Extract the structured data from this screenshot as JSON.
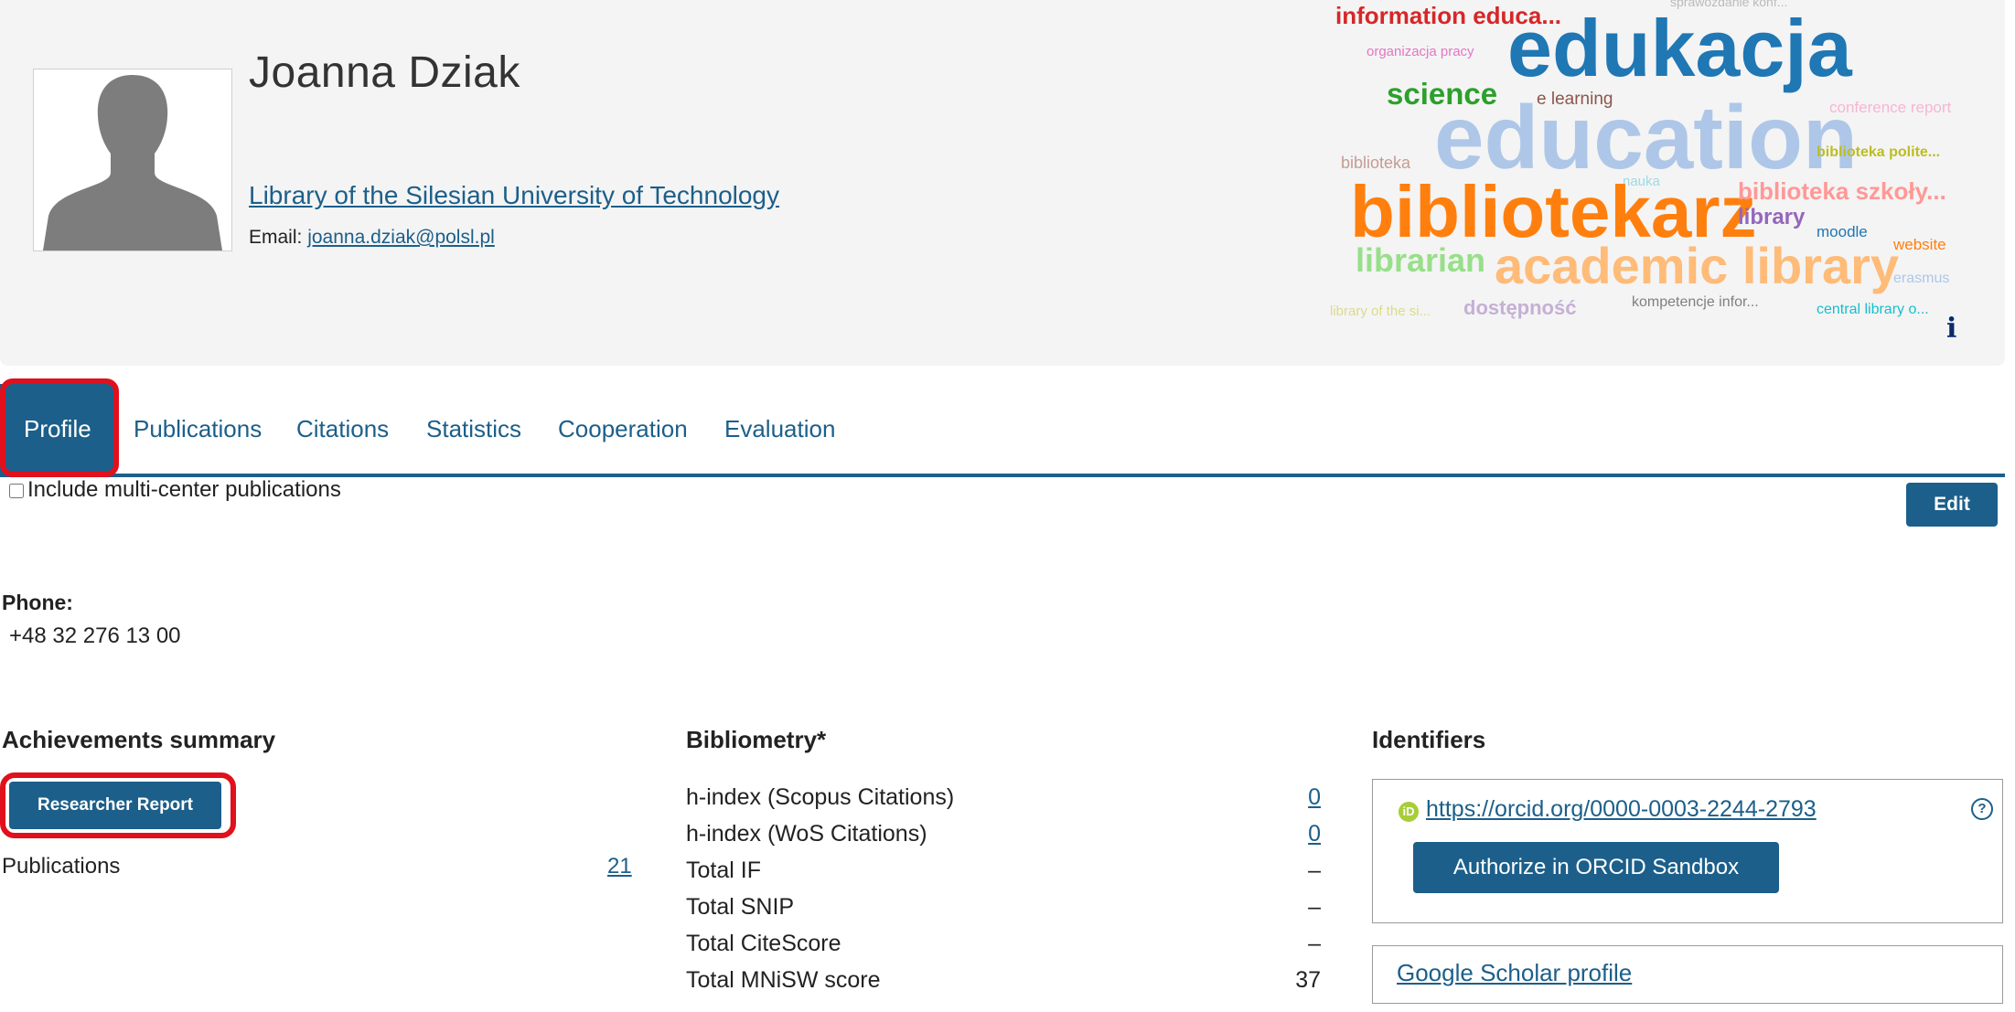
{
  "profile": {
    "name": "Joanna Dziak",
    "affiliation": "Library of the Silesian University of Technology",
    "email_label": "Email:",
    "email": "joanna.dziak@polsl.pl"
  },
  "word_cloud": [
    {
      "text": "sprawozdanie konf...",
      "color": "#bbbbbb"
    },
    {
      "text": "information educa...",
      "color": "#d62728"
    },
    {
      "text": "edukacja",
      "color": "#1f77b4"
    },
    {
      "text": "organizacja pracy",
      "color": "#e377c2"
    },
    {
      "text": "science",
      "color": "#2ca02c"
    },
    {
      "text": "e learning",
      "color": "#8c564b"
    },
    {
      "text": "conference report",
      "color": "#f7b6d2"
    },
    {
      "text": "education",
      "color": "#aec7e8"
    },
    {
      "text": "biblioteka",
      "color": "#c49c94"
    },
    {
      "text": "nauka",
      "color": "#9edae5"
    },
    {
      "text": "biblioteka polite...",
      "color": "#bcbd22"
    },
    {
      "text": "bibliotekarz",
      "color": "#ff7f0e"
    },
    {
      "text": "biblioteka szkoły...",
      "color": "#ff9896"
    },
    {
      "text": "library",
      "color": "#9467bd"
    },
    {
      "text": "moodle",
      "color": "#1f77b4"
    },
    {
      "text": "website",
      "color": "#ff7f0e"
    },
    {
      "text": "librarian",
      "color": "#98df8a"
    },
    {
      "text": "academic library",
      "color": "#ffbb78"
    },
    {
      "text": "erasmus",
      "color": "#aec7e8"
    },
    {
      "text": "library of the si...",
      "color": "#dbdb8d"
    },
    {
      "text": "dostępność",
      "color": "#c5b0d5"
    },
    {
      "text": "kompetencje infor...",
      "color": "#7f7f7f"
    },
    {
      "text": "central library o...",
      "color": "#17becf"
    }
  ],
  "info_icon": "i",
  "tabs": [
    {
      "label": "Profile",
      "active": true
    },
    {
      "label": "Publications",
      "active": false
    },
    {
      "label": "Citations",
      "active": false
    },
    {
      "label": "Statistics",
      "active": false
    },
    {
      "label": "Cooperation",
      "active": false
    },
    {
      "label": "Evaluation",
      "active": false
    }
  ],
  "multi_center_label": "Include multi-center publications",
  "edit_label": "Edit",
  "phone": {
    "label": "Phone:",
    "value": "+48 32 276 13 00"
  },
  "achievements": {
    "title": "Achievements summary",
    "report_button": "Researcher Report",
    "publications_label": "Publications",
    "publications_value": "21"
  },
  "bibliometry": {
    "title": "Bibliometry*",
    "rows": [
      {
        "label": "h-index (Scopus Citations)",
        "value": "0",
        "link": true
      },
      {
        "label": "h-index (WoS Citations)",
        "value": "0",
        "link": true
      },
      {
        "label": "Total IF",
        "value": "–",
        "link": false
      },
      {
        "label": "Total SNIP",
        "value": "–",
        "link": false
      },
      {
        "label": "Total CiteScore",
        "value": "–",
        "link": false
      },
      {
        "label": "Total MNiSW score",
        "value": "37",
        "link": false
      }
    ]
  },
  "identifiers": {
    "title": "Identifiers",
    "orcid_icon": "iD",
    "orcid_url": "https://orcid.org/0000-0003-2244-2793",
    "help_icon": "?",
    "authorize_button": "Authorize in ORCID Sandbox",
    "google_scholar": "Google Scholar profile"
  },
  "colors": {
    "primary": "#1c5f8a",
    "highlight": "#e0101c",
    "header_bg": "#f4f4f4"
  }
}
